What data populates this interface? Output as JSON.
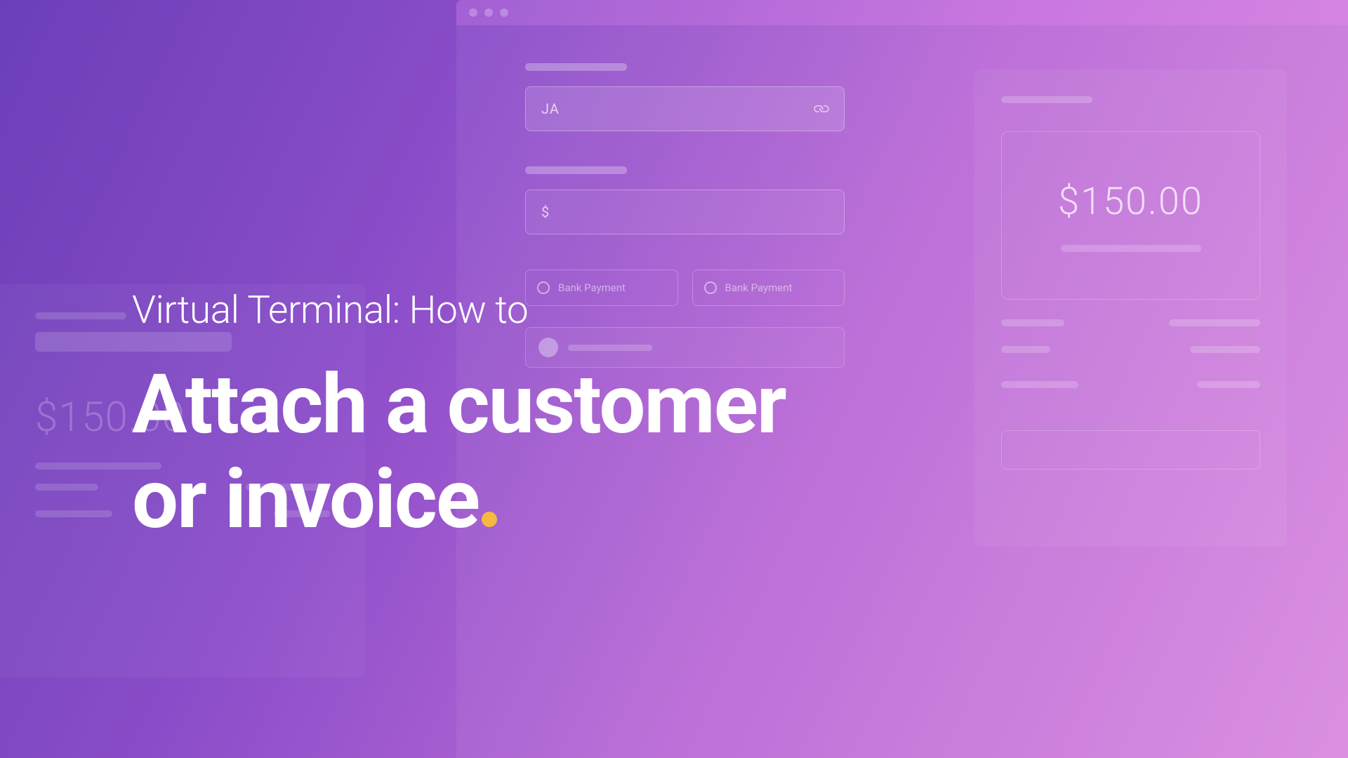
{
  "title": {
    "eyebrow": "Virtual Terminal: How to",
    "headline_line1": "Attach a customer",
    "headline_line2": "or invoice"
  },
  "form": {
    "customer_initials": "JA",
    "amount_prefix": "$",
    "radio_options": [
      {
        "label": "Bank Payment"
      },
      {
        "label": "Bank Payment"
      }
    ]
  },
  "summary": {
    "amount": "$150.00"
  },
  "left_panel": {
    "amount": "$150.00"
  }
}
